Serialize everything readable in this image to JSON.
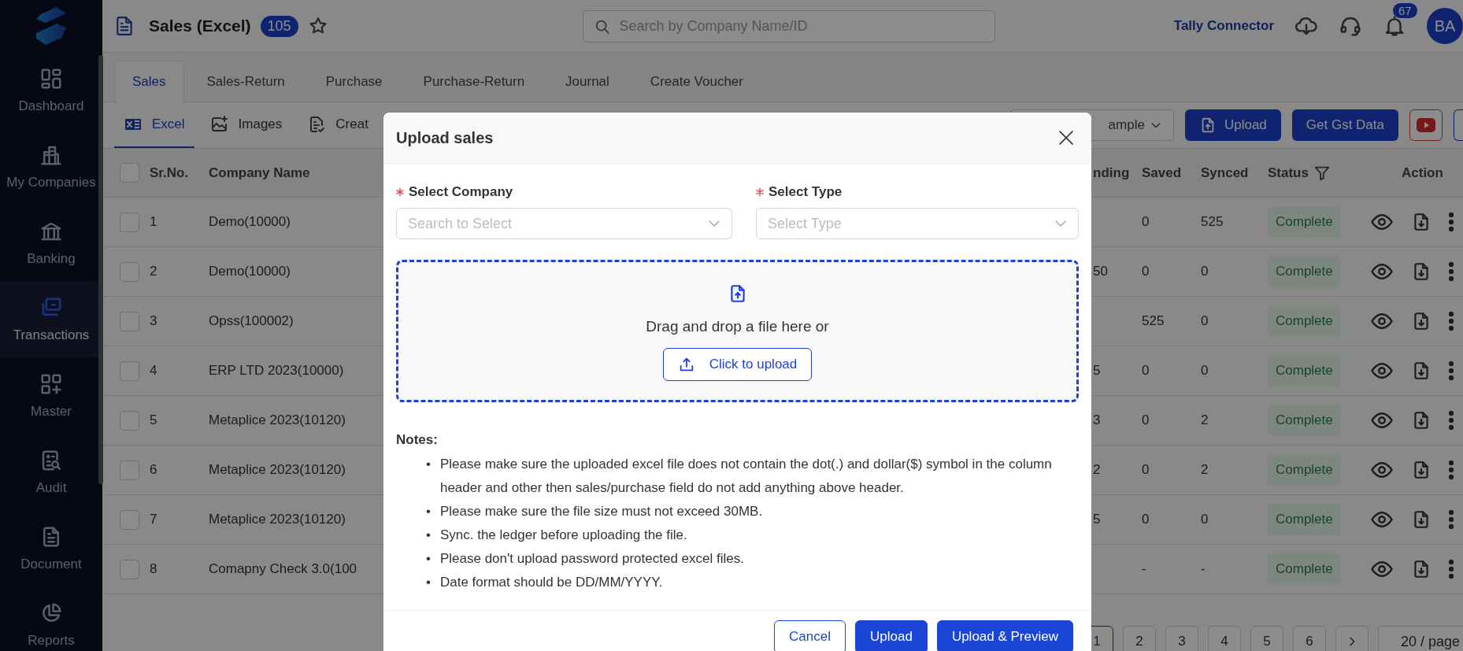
{
  "sidebar": {
    "items": [
      {
        "label": "Dashboard",
        "selected": false
      },
      {
        "label": "My Companies",
        "selected": false
      },
      {
        "label": "Banking",
        "selected": false
      },
      {
        "label": "Transactions",
        "selected": true
      },
      {
        "label": "Master",
        "selected": false
      },
      {
        "label": "Audit",
        "selected": false
      },
      {
        "label": "Document",
        "selected": false
      },
      {
        "label": "Reports",
        "selected": false
      }
    ]
  },
  "header": {
    "title": "Sales (Excel)",
    "count": "105",
    "search": {
      "placeholder": "Search by Company Name/ID"
    },
    "link": "Tally Connector",
    "notifications": "67",
    "avatar": "BA"
  },
  "tabs": [
    {
      "label": "Sales",
      "selected": true
    },
    {
      "label": "Sales-Return",
      "selected": false
    },
    {
      "label": "Purchase",
      "selected": false
    },
    {
      "label": "Purchase-Return",
      "selected": false
    },
    {
      "label": "Journal",
      "selected": false
    },
    {
      "label": "Create Voucher",
      "selected": false
    }
  ],
  "subtabs": [
    {
      "label": "Excel",
      "selected": true
    },
    {
      "label": "Images",
      "selected": false
    },
    {
      "label": "Creat",
      "selected": false
    }
  ],
  "toolbar": {
    "dropdown": "ample",
    "buttons": [
      "Upload",
      "Get Gst Data"
    ]
  },
  "table": {
    "columns": [
      "Sr.No.",
      "Company Name",
      "nding",
      "Saved",
      "Synced",
      "Status",
      "Action"
    ],
    "header_checked": false,
    "rows": [
      {
        "checked": false,
        "sr": "1",
        "company": "Demo(10000)",
        "saved": "0",
        "synced": "525",
        "status": "Complete"
      },
      {
        "checked": false,
        "sr": "2",
        "company": "Demo(10000)",
        "pending": "50",
        "saved": "0",
        "synced": "0",
        "status": "Complete"
      },
      {
        "checked": false,
        "sr": "3",
        "company": "Opss(100002)",
        "saved": "525",
        "synced": "0",
        "status": "Complete"
      },
      {
        "checked": false,
        "sr": "4",
        "company": "ERP LTD 2023(10000)",
        "pending": "5",
        "saved": "0",
        "synced": "0",
        "status": "Complete"
      },
      {
        "checked": false,
        "sr": "5",
        "company": "Metaplice 2023(10120)",
        "pending": "3",
        "saved": "0",
        "synced": "2",
        "status": "Complete"
      },
      {
        "checked": false,
        "sr": "6",
        "company": "Metaplice 2023(10120)",
        "pending": "2",
        "saved": "0",
        "synced": "2",
        "status": "Complete"
      },
      {
        "checked": false,
        "sr": "7",
        "company": "Metaplice 2023(10120)",
        "pending": "5",
        "saved": "0",
        "synced": "0",
        "status": "Complete"
      },
      {
        "checked": false,
        "sr": "8",
        "company": "Comapny Check 3.0(100",
        "saved": "-",
        "synced": "-",
        "status": "Complete"
      }
    ]
  },
  "pagination": {
    "pages": [
      {
        "label": "1",
        "selected": true
      },
      {
        "label": "2",
        "selected": false
      },
      {
        "label": "3",
        "selected": false
      },
      {
        "label": "4",
        "selected": false
      },
      {
        "label": "5",
        "selected": false
      },
      {
        "label": "6",
        "selected": false
      }
    ],
    "page_size": "20 / page"
  },
  "modal": {
    "title": "Upload sales",
    "fields": [
      {
        "label": "Select Company",
        "required": true,
        "placeholder": "Search to Select"
      },
      {
        "label": "Select Type",
        "required": true,
        "placeholder": "Select Type"
      }
    ],
    "dropzone": {
      "text": "Drag and drop a file here or",
      "button": "Click to upload"
    },
    "notes": {
      "title": "Notes:",
      "items": [
        {
          "bullet": "•",
          "text": "Please make sure the uploaded excel file does not contain the dot(.) and dollar($) symbol in the column header and other then sales/purchase field do not add anything above header."
        },
        {
          "bullet": "•",
          "text": "Please make sure the file size must not exceed 30MB."
        },
        {
          "bullet": "•",
          "text": "Sync. the ledger before uploading the file."
        },
        {
          "bullet": "•",
          "text": "Please don't upload password protected excel files."
        },
        {
          "bullet": "•",
          "text": "Date format should be DD/MM/YYYY."
        }
      ]
    },
    "buttons": [
      {
        "label": "Cancel",
        "kind": "secondary"
      },
      {
        "label": "Upload",
        "kind": "primary"
      },
      {
        "label": "Upload & Preview",
        "kind": "primary"
      }
    ]
  }
}
